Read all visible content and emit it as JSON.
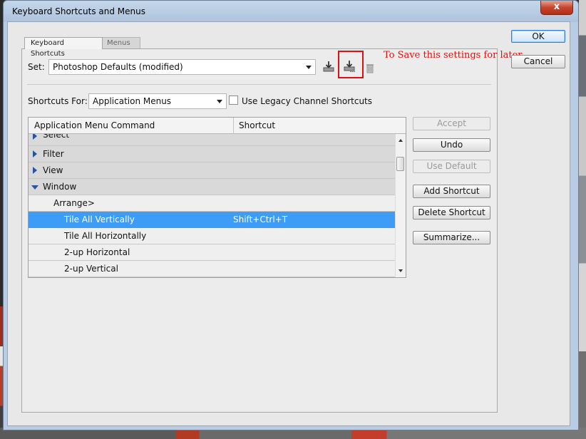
{
  "window": {
    "title": "Keyboard Shortcuts and Menus",
    "close_label": "x"
  },
  "tabs": [
    {
      "label": "Keyboard Shortcuts",
      "active": true
    },
    {
      "label": "Menus",
      "active": false
    }
  ],
  "set": {
    "label": "Set:",
    "value": "Photoshop Defaults (modified)"
  },
  "icons": {
    "save_set": "save-icon",
    "save_as_set": "save-as-icon",
    "delete_set": "trash-icon"
  },
  "annotation": {
    "text": "To Save this settings for later",
    "color": "#e01010"
  },
  "shortcuts_for": {
    "label": "Shortcuts For:",
    "value": "Application Menus",
    "legacy_label": "Use Legacy Channel Shortcuts",
    "legacy_checked": false
  },
  "table": {
    "col_command": "Application Menu Command",
    "col_shortcut": "Shortcut",
    "rows": [
      {
        "command": "Select",
        "shortcut": "",
        "type": "group",
        "expanded": false
      },
      {
        "command": "Filter",
        "shortcut": "",
        "type": "group",
        "expanded": false
      },
      {
        "command": "View",
        "shortcut": "",
        "type": "group",
        "expanded": false
      },
      {
        "command": "Window",
        "shortcut": "",
        "type": "group",
        "expanded": true
      },
      {
        "command": "Arrange>",
        "shortcut": "",
        "type": "item"
      },
      {
        "command": "Tile All Vertically",
        "shortcut": "Shift+Ctrl+T",
        "type": "item",
        "selected": true
      },
      {
        "command": "Tile All Horizontally",
        "shortcut": "",
        "type": "item"
      },
      {
        "command": "2-up Horizontal",
        "shortcut": "",
        "type": "item"
      },
      {
        "command": "2-up Vertical",
        "shortcut": "",
        "type": "item"
      }
    ]
  },
  "buttons": {
    "ok": "OK",
    "cancel": "Cancel",
    "accept": "Accept",
    "undo": "Undo",
    "use_default": "Use Default",
    "add_shortcut": "Add Shortcut",
    "delete_shortcut": "Delete Shortcut",
    "summarize": "Summarize..."
  },
  "colors": {
    "selection": "#3d9cf6",
    "annotation": "#e01010"
  }
}
